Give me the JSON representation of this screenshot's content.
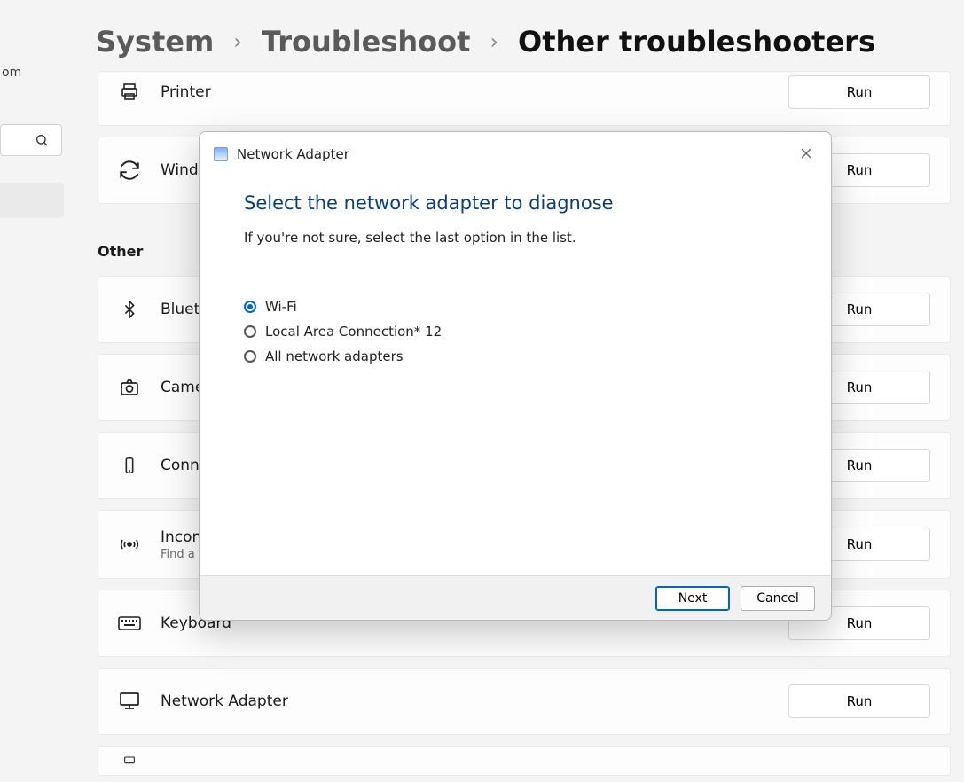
{
  "sidebar": {
    "account_stub": "om"
  },
  "breadcrumb": {
    "l1": "System",
    "l2": "Troubleshoot",
    "current": "Other troubleshooters"
  },
  "sections": {
    "other_label": "Other"
  },
  "items": {
    "printer": {
      "title": "Printer",
      "run": "Run"
    },
    "update": {
      "title": "Wind",
      "run": "Run"
    },
    "bluetooth": {
      "title": "Bluet",
      "run": "Run"
    },
    "camera": {
      "title": "Came",
      "run": "Run"
    },
    "connected": {
      "title": "Conn",
      "run": "Run"
    },
    "incoming": {
      "title": "Incon",
      "sub": "Find a",
      "run": "Run"
    },
    "keyboard": {
      "title": "Keyboard",
      "run": "Run"
    },
    "network": {
      "title": "Network Adapter",
      "run": "Run"
    }
  },
  "dialog": {
    "header": "Network Adapter",
    "title": "Select the network adapter to diagnose",
    "desc": "If you're not sure, select the last option in the list.",
    "options": {
      "o1": "Wi-Fi",
      "o2": "Local Area Connection* 12",
      "o3": "All network adapters"
    },
    "selected_index": 0,
    "next": "Next",
    "cancel": "Cancel"
  }
}
